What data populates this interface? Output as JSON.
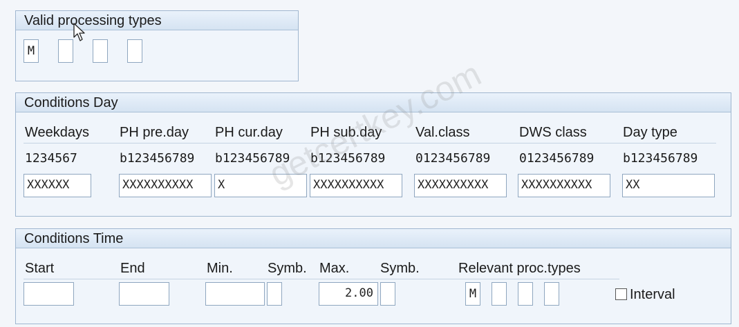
{
  "valid_processing_types": {
    "title": "Valid processing types",
    "fields": [
      "M",
      "",
      "",
      ""
    ]
  },
  "conditions_day": {
    "title": "Conditions Day",
    "columns": [
      {
        "label": "Weekdays",
        "mask": "1234567",
        "value": "XXXXXX"
      },
      {
        "label": "PH pre.day",
        "mask": "b123456789",
        "value": "XXXXXXXXXX"
      },
      {
        "label": "PH cur.day",
        "mask": "b123456789",
        "value": "X"
      },
      {
        "label": "PH sub.day",
        "mask": "b123456789",
        "value": "XXXXXXXXXX"
      },
      {
        "label": "Val.class",
        "mask": "0123456789",
        "value": "XXXXXXXXXX"
      },
      {
        "label": "DWS class",
        "mask": "0123456789",
        "value": "XXXXXXXXXX"
      },
      {
        "label": "Day type",
        "mask": "b123456789",
        "value": "XX"
      }
    ]
  },
  "conditions_time": {
    "title": "Conditions Time",
    "start_label": "Start",
    "end_label": "End",
    "min_label": "Min.",
    "symb_label": "Symb.",
    "max_label": "Max.",
    "symb2_label": "Symb.",
    "relevant_label": "Relevant proc.types",
    "start_value": "",
    "end_value": "",
    "min_value": "",
    "symb_value": "",
    "max_value": "2.00",
    "symb2_value": "",
    "relevant_types": [
      "M",
      "",
      "",
      ""
    ],
    "interval_label": "Interval",
    "interval_checked": false
  },
  "watermark": "getcertkey.com"
}
